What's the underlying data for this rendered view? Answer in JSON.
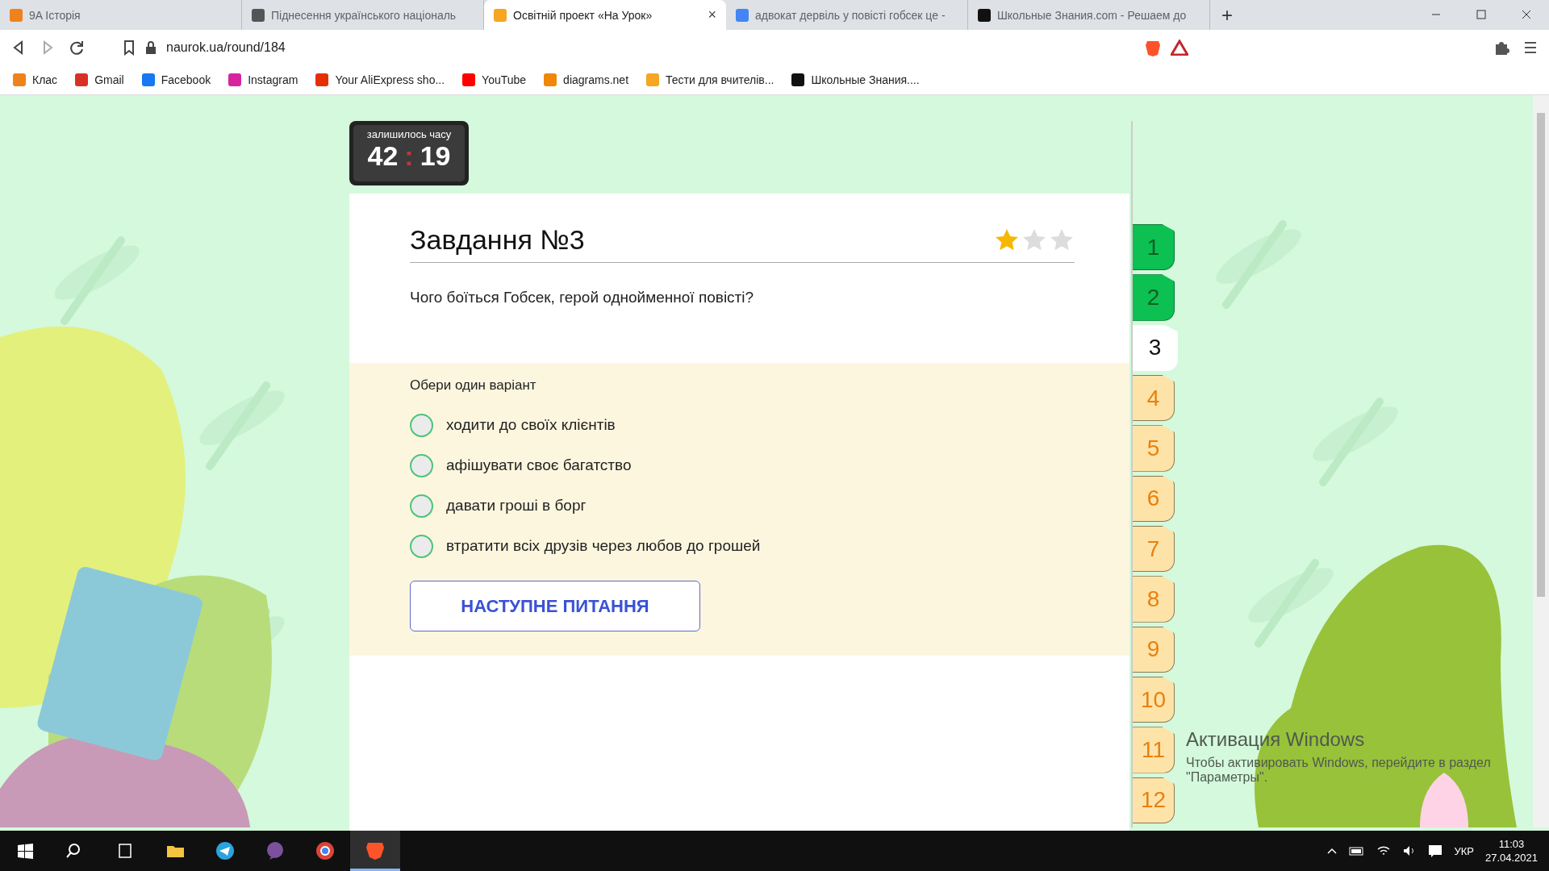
{
  "browser": {
    "tabs": [
      {
        "title": "9A Історія",
        "selected": false
      },
      {
        "title": "Піднесення українського національ",
        "selected": false
      },
      {
        "title": "Освітній проект «На Урок»",
        "selected": true
      },
      {
        "title": "адвокат дервіль у повісті гобсек це -",
        "selected": false
      },
      {
        "title": "Школьные Знания.com - Решаем до",
        "selected": false
      }
    ],
    "close_tab": "×",
    "new_tab": "+",
    "address": "naurok.ua/round/184",
    "bookmarks": [
      "Клас",
      "Gmail",
      "Facebook",
      "Instagram",
      "Your AliExpress sho...",
      "YouTube",
      "diagrams.net",
      "Тести для вчителів...",
      "Школьные Знания...."
    ]
  },
  "timer": {
    "label": "залишилось часу",
    "minutes": "42",
    "separator": ":",
    "seconds": "19"
  },
  "task": {
    "title": "Завдання №3",
    "stars": 1,
    "question": "Чого боїться Гобсек, герой однойменної повісті?",
    "instruction": "Обери один варіант",
    "options": [
      {
        "text": "ходити до своїх клієнтів",
        "selected": false
      },
      {
        "text": "афішувати своє багатство",
        "selected": false
      },
      {
        "text": "давати гроші в борг",
        "selected": false
      },
      {
        "text": "втратити всіх друзів через любов до грошей",
        "selected": false
      }
    ],
    "next_button": "НАСТУПНЕ ПИТАННЯ"
  },
  "question_tabs": [
    {
      "label": "1",
      "answered": true,
      "selected": false
    },
    {
      "label": "2",
      "answered": true,
      "selected": false
    },
    {
      "label": "3",
      "answered": false,
      "selected": true
    },
    {
      "label": "4",
      "answered": false,
      "selected": false
    },
    {
      "label": "5",
      "answered": false,
      "selected": false
    },
    {
      "label": "6",
      "answered": false,
      "selected": false
    },
    {
      "label": "7",
      "answered": false,
      "selected": false
    },
    {
      "label": "8",
      "answered": false,
      "selected": false
    },
    {
      "label": "9",
      "answered": false,
      "selected": false
    },
    {
      "label": "10",
      "answered": false,
      "selected": false
    },
    {
      "label": "11",
      "answered": false,
      "selected": false
    },
    {
      "label": "12",
      "answered": false,
      "selected": false
    }
  ],
  "activation_notice": {
    "title": "Активация Windows",
    "text": "Чтобы активировать Windows, перейдите в раздел \"Параметры\"."
  },
  "taskbar": {
    "language": "УКР",
    "time": "11:03",
    "date": "27.04.2021"
  }
}
